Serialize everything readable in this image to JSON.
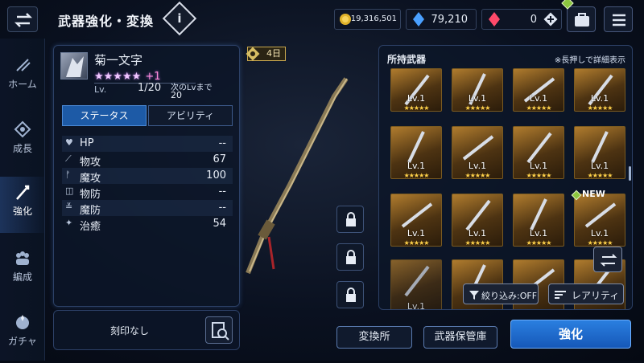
{
  "header": {
    "title": "武器強化・変換",
    "info": "i"
  },
  "currency": {
    "gold": "19,316,501",
    "crystal": "79,210",
    "ruby": "0"
  },
  "nav": [
    {
      "label": "ホーム",
      "icon": "home-icon"
    },
    {
      "label": "成長",
      "icon": "growth-icon"
    },
    {
      "label": "強化",
      "icon": "enhance-icon"
    },
    {
      "label": "編成",
      "icon": "party-icon"
    },
    {
      "label": "ガチャ",
      "icon": "gacha-icon"
    }
  ],
  "weapon": {
    "name": "菊一文字",
    "stars": "★★★★★",
    "plus": "+1",
    "lv_label": "Lv.",
    "lv_value": "1/20",
    "next_label": "次のLvまで",
    "next_value": "20"
  },
  "tabs": {
    "status": "ステータス",
    "ability": "アビリティ"
  },
  "stats": [
    {
      "k": "HP",
      "v": "--",
      "icon": "♥"
    },
    {
      "k": "物攻",
      "v": "67",
      "icon": "⟋"
    },
    {
      "k": "魔攻",
      "v": "100",
      "icon": "ᚠ"
    },
    {
      "k": "物防",
      "v": "--",
      "icon": "◫"
    },
    {
      "k": "魔防",
      "v": "--",
      "icon": "≚"
    },
    {
      "k": "治癒",
      "v": "54",
      "icon": "✦"
    }
  ],
  "engraving": {
    "text": "刻印なし"
  },
  "badge": {
    "days": "4日"
  },
  "inventory": {
    "title": "所持武器",
    "hint": "※長押しで詳細表示",
    "new_label": "NEW",
    "lv": "Lv.1",
    "stars": "★★★★★"
  },
  "filters": {
    "filter": "絞り込み:OFF",
    "rarity": "レアリティ"
  },
  "buttons": {
    "exchange": "変換所",
    "storage": "武器保管庫",
    "enhance": "強化"
  }
}
